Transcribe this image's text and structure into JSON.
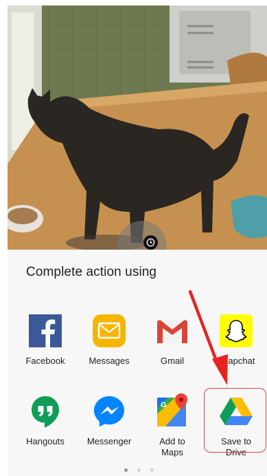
{
  "sheet": {
    "title": "Complete action using"
  },
  "apps_row1": [
    {
      "label": "Facebook",
      "icon": "facebook-icon"
    },
    {
      "label": "Messages",
      "icon": "messages-icon"
    },
    {
      "label": "Gmail",
      "icon": "gmail-icon"
    },
    {
      "label": "Snapchat",
      "icon": "snapchat-icon"
    }
  ],
  "apps_row2": [
    {
      "label": "Hangouts",
      "icon": "hangouts-icon"
    },
    {
      "label": "Messenger",
      "icon": "messenger-icon"
    },
    {
      "label": "Add to\nMaps",
      "icon": "maps-icon"
    },
    {
      "label": "Save to\nDrive",
      "icon": "drive-icon"
    }
  ],
  "pager": {
    "pages": 3,
    "current": 1
  },
  "colors": {
    "annotation_red": "#e8231f",
    "facebook": "#3b5998",
    "messages": "#f7b500",
    "gmail": "#d44638",
    "snapchat": "#fffc00",
    "hangouts": "#0f9d58",
    "messenger": "#0084ff"
  }
}
